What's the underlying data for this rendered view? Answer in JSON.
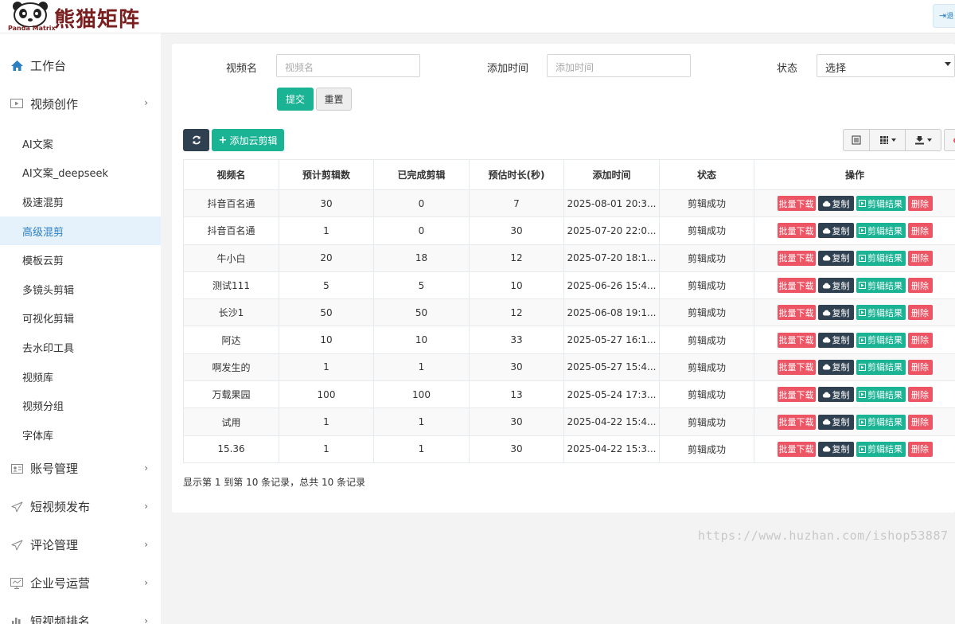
{
  "header": {
    "logo_text": "熊猫矩阵",
    "logo_sub": "Panda Matrix",
    "exit_label": "退"
  },
  "sidebar": {
    "workbench": "工作台",
    "video_creation": "视频创作",
    "sub_items": [
      "AI文案",
      "AI文案_deepseek",
      "极速混剪",
      "高级混剪",
      "模板云剪",
      "多镜头剪辑",
      "可视化剪辑",
      "去水印工具",
      "视频库",
      "视频分组",
      "字体库"
    ],
    "account_mgmt": "账号管理",
    "short_video_publish": "短视频发布",
    "comment_mgmt": "评论管理",
    "enterprise_ops": "企业号运营",
    "short_video_rank": "短视频排名"
  },
  "form": {
    "video_name_label": "视频名",
    "video_name_placeholder": "视频名",
    "add_time_label": "添加时间",
    "add_time_placeholder": "添加时间",
    "status_label": "状态",
    "status_value": "选择",
    "submit_label": "提交",
    "reset_label": "重置"
  },
  "toolbar": {
    "add_label": "添加云剪辑"
  },
  "table": {
    "headers": [
      "视频名",
      "预计剪辑数",
      "已完成剪辑",
      "预估时长(秒)",
      "添加时间",
      "状态",
      "操作"
    ],
    "op_labels": {
      "download": "批量下载",
      "copy": "复制",
      "result": "剪辑结果",
      "delete": "删除"
    },
    "rows": [
      {
        "name": "抖音百名通",
        "planned": "30",
        "done": "0",
        "duration": "7",
        "time": "2025-08-01 20:3...",
        "status": "剪辑成功"
      },
      {
        "name": "抖音百名通",
        "planned": "1",
        "done": "0",
        "duration": "30",
        "time": "2025-07-20 22:0...",
        "status": "剪辑成功"
      },
      {
        "name": "牛小白",
        "planned": "20",
        "done": "18",
        "duration": "12",
        "time": "2025-07-20 18:1...",
        "status": "剪辑成功"
      },
      {
        "name": "测试111",
        "planned": "5",
        "done": "5",
        "duration": "10",
        "time": "2025-06-26 15:4...",
        "status": "剪辑成功"
      },
      {
        "name": "长沙1",
        "planned": "50",
        "done": "50",
        "duration": "12",
        "time": "2025-06-08 19:1...",
        "status": "剪辑成功"
      },
      {
        "name": "阿达",
        "planned": "10",
        "done": "10",
        "duration": "33",
        "time": "2025-05-27 16:1...",
        "status": "剪辑成功"
      },
      {
        "name": "啊发生的",
        "planned": "1",
        "done": "1",
        "duration": "30",
        "time": "2025-05-27 15:4...",
        "status": "剪辑成功"
      },
      {
        "name": "万载果园",
        "planned": "100",
        "done": "100",
        "duration": "13",
        "time": "2025-05-24 17:3...",
        "status": "剪辑成功"
      },
      {
        "name": "试用",
        "planned": "1",
        "done": "1",
        "duration": "30",
        "time": "2025-04-22 15:4...",
        "status": "剪辑成功"
      },
      {
        "name": "15.36",
        "planned": "1",
        "done": "1",
        "duration": "30",
        "time": "2025-04-22 15:3...",
        "status": "剪辑成功"
      }
    ],
    "summary": "显示第 1 到第 10 条记录，总共 10 条记录"
  },
  "watermark": "https://www.huzhan.com/ishop53887",
  "colors": {
    "primary_green": "#1ab394",
    "dark": "#2f4050",
    "danger": "#ed5565",
    "warning": "#f8ac59",
    "accent_blue": "#2b7fc1"
  }
}
